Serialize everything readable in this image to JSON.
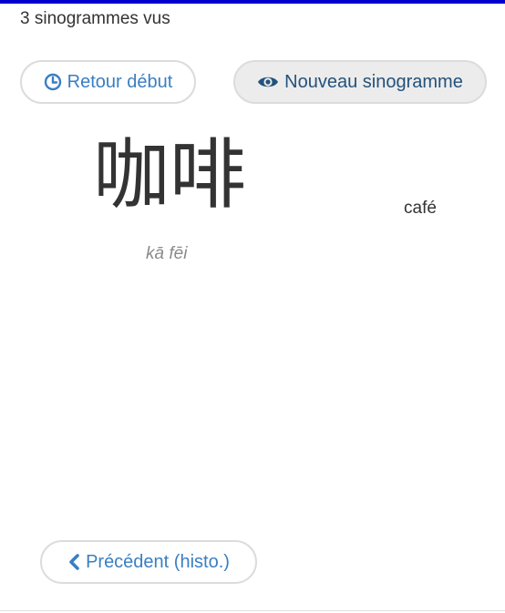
{
  "header": {
    "counter_text": "3 sinogrammes vus"
  },
  "toolbar": {
    "restart_label": "Retour début",
    "restart_icon": "clock-icon",
    "new_label": "Nouveau sinogramme",
    "new_icon": "eye-icon"
  },
  "card": {
    "characters": "咖啡",
    "pinyin": "kā fēi",
    "meaning": "café"
  },
  "footer": {
    "prev_label": "Précédent (histo.)",
    "prev_icon": "chevron-left-icon"
  },
  "colors": {
    "accent": "#3a7fc2",
    "top_bar": "#0000cc",
    "pinyin": "#8a8a8a"
  }
}
